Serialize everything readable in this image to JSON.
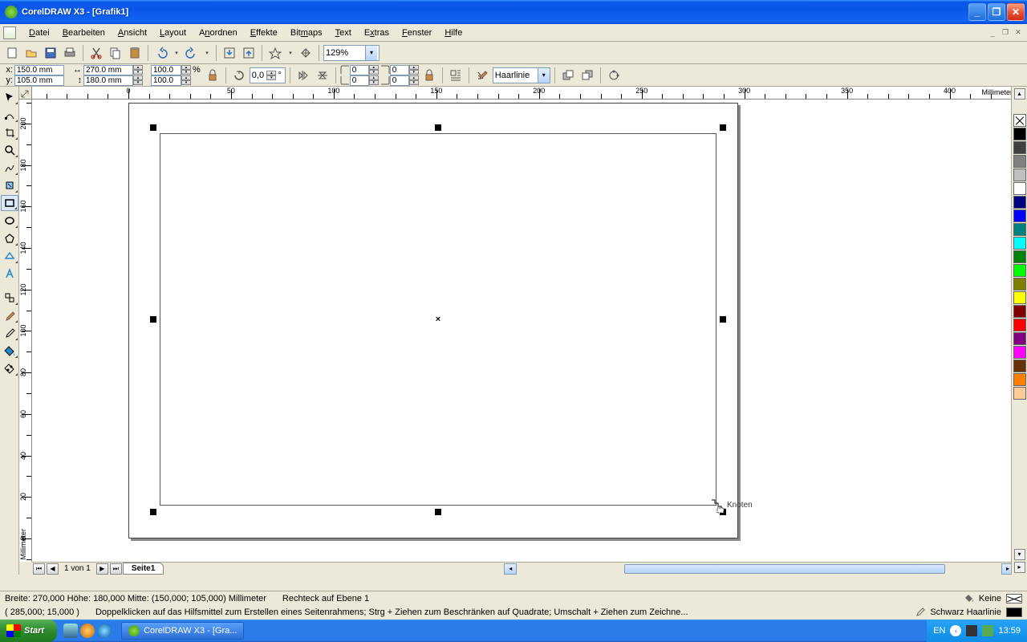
{
  "titlebar": {
    "text": "CorelDRAW X3 - [Grafik1]"
  },
  "menu": {
    "items": [
      "Datei",
      "Bearbeiten",
      "Ansicht",
      "Layout",
      "Anordnen",
      "Effekte",
      "Bitmaps",
      "Text",
      "Extras",
      "Fenster",
      "Hilfe"
    ]
  },
  "toolbar": {
    "zoom": "129%"
  },
  "propbar": {
    "x": "150.0 mm",
    "y": "105.0 mm",
    "width": "270.0 mm",
    "height": "180.0 mm",
    "scale_x": "100.0",
    "scale_y": "100.0",
    "rotation": "0,0",
    "corner1": "0",
    "corner2": "0",
    "corner3": "0",
    "corner4": "0",
    "outline": "Haarlinie"
  },
  "ruler": {
    "unit_h": "Millimeter",
    "unit_v": "Millimeter"
  },
  "pagenav": {
    "pages": "1 von 1",
    "tab": "Seite1"
  },
  "status": {
    "dims": "Breite: 270,000  Höhe: 180,000  Mitte: (150,000; 105,000) Millimeter",
    "obj": "Rechteck auf Ebene 1",
    "fill": "Keine",
    "coord": "( 285,000; 15,000 )",
    "hint": "Doppelklicken auf das Hilfsmittel zum Erstellen eines Seitenrahmens; Strg + Ziehen zum Beschränken auf Quadrate; Umschalt + Ziehen zum Zeichne...",
    "outline": "Schwarz Haarlinie"
  },
  "cursor": {
    "label": "Knoten"
  },
  "taskbar": {
    "start": "Start",
    "task": "CorelDRAW X3 - [Gra...",
    "lang": "EN",
    "time": "13:59"
  },
  "palette": {
    "colors": [
      "#000000",
      "#404040",
      "#808080",
      "#c0c0c0",
      "#ffffff",
      "#000080",
      "#0000ff",
      "#008080",
      "#00ffff",
      "#008000",
      "#00ff00",
      "#808000",
      "#ffff00",
      "#800000",
      "#ff0000",
      "#800080",
      "#ff00ff",
      "#663300",
      "#ff8000",
      "#ffcc99"
    ]
  }
}
